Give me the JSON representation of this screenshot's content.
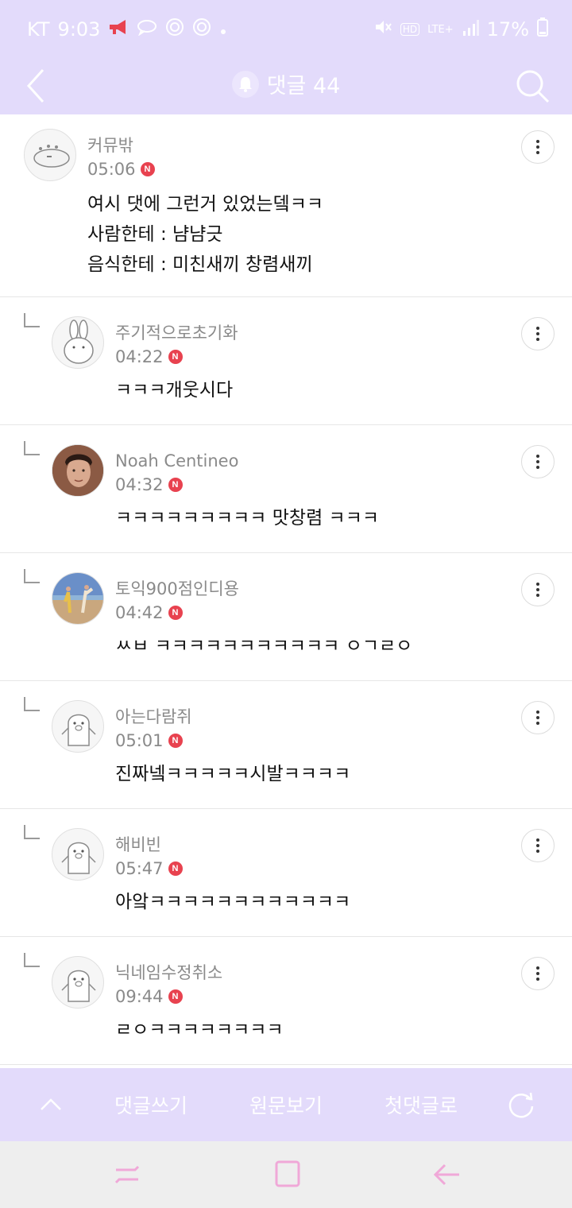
{
  "status_bar": {
    "carrier": "KT",
    "time": "9:03",
    "network_hd": "HD",
    "network_type": "LTE+",
    "battery": "17%"
  },
  "header": {
    "title": "댓글 44",
    "back_icon": "chevron-left-icon",
    "search_icon": "search-icon",
    "bell_icon": "bell-icon"
  },
  "comments": [
    {
      "author": "커뮤밖",
      "time": "05:06",
      "new_badge": "N",
      "body": "여시 댓에 그런거 있었는뎈ㅋㅋ\n사람한테 : 냠냠긋\n음식한테 : 미친새끼 창렴새끼"
    },
    {
      "author": "주기적으로초기화",
      "time": "04:22",
      "new_badge": "N",
      "body": "ㅋㅋㅋ개웃시다"
    },
    {
      "author": "Noah Centineo",
      "time": "04:32",
      "new_badge": "N",
      "body": "ㅋㅋㅋㅋㅋㅋㅋㅋㅋ 맛창렴 ㅋㅋㅋ"
    },
    {
      "author": "토익900점인디용",
      "time": "04:42",
      "new_badge": "N",
      "body": "ㅆㅂ ㅋㅋㅋㅋㅋㅋㅋㅋㅋㅋㅋ ㅇㄱㄹㅇ"
    },
    {
      "author": "아는다람쥐",
      "time": "05:01",
      "new_badge": "N",
      "body": "진짜넼ㅋㅋㅋㅋㅋ시발ㅋㅋㅋㅋ"
    },
    {
      "author": "해비빈",
      "time": "05:47",
      "new_badge": "N",
      "body": "아앜ㅋㅋㅋㅋㅋㅋㅋㅋㅋㅋㅋㅋ"
    },
    {
      "author": "닉네임수정취소",
      "time": "09:44",
      "new_badge": "N",
      "body": "ㄹㅇㅋㅋㅋㅋㅋㅋㅋㅋ"
    }
  ],
  "toolbar": {
    "write": "댓글쓰기",
    "original": "원문보기",
    "first": "첫댓글로"
  },
  "colors": {
    "accent": "#e3dbfb",
    "badge": "#e8424f"
  }
}
